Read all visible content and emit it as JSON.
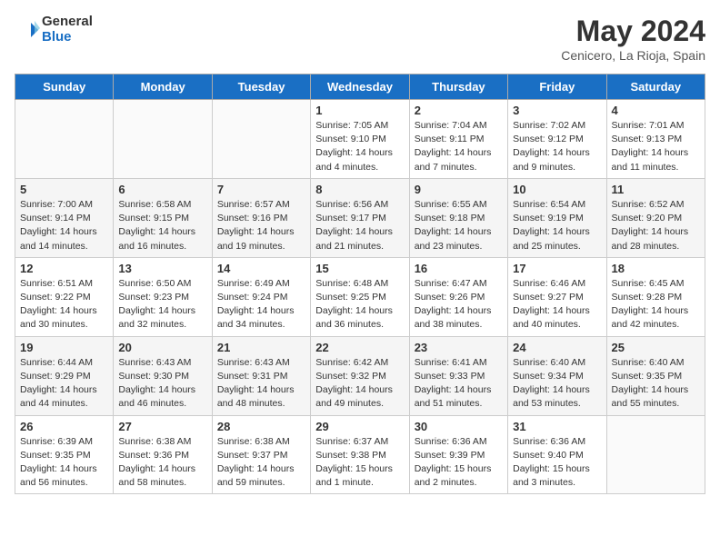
{
  "header": {
    "logo_line1": "General",
    "logo_line2": "Blue",
    "month_title": "May 2024",
    "subtitle": "Cenicero, La Rioja, Spain"
  },
  "days_of_week": [
    "Sunday",
    "Monday",
    "Tuesday",
    "Wednesday",
    "Thursday",
    "Friday",
    "Saturday"
  ],
  "weeks": [
    [
      {
        "day": "",
        "info": ""
      },
      {
        "day": "",
        "info": ""
      },
      {
        "day": "",
        "info": ""
      },
      {
        "day": "1",
        "info": "Sunrise: 7:05 AM\nSunset: 9:10 PM\nDaylight: 14 hours\nand 4 minutes."
      },
      {
        "day": "2",
        "info": "Sunrise: 7:04 AM\nSunset: 9:11 PM\nDaylight: 14 hours\nand 7 minutes."
      },
      {
        "day": "3",
        "info": "Sunrise: 7:02 AM\nSunset: 9:12 PM\nDaylight: 14 hours\nand 9 minutes."
      },
      {
        "day": "4",
        "info": "Sunrise: 7:01 AM\nSunset: 9:13 PM\nDaylight: 14 hours\nand 11 minutes."
      }
    ],
    [
      {
        "day": "5",
        "info": "Sunrise: 7:00 AM\nSunset: 9:14 PM\nDaylight: 14 hours\nand 14 minutes."
      },
      {
        "day": "6",
        "info": "Sunrise: 6:58 AM\nSunset: 9:15 PM\nDaylight: 14 hours\nand 16 minutes."
      },
      {
        "day": "7",
        "info": "Sunrise: 6:57 AM\nSunset: 9:16 PM\nDaylight: 14 hours\nand 19 minutes."
      },
      {
        "day": "8",
        "info": "Sunrise: 6:56 AM\nSunset: 9:17 PM\nDaylight: 14 hours\nand 21 minutes."
      },
      {
        "day": "9",
        "info": "Sunrise: 6:55 AM\nSunset: 9:18 PM\nDaylight: 14 hours\nand 23 minutes."
      },
      {
        "day": "10",
        "info": "Sunrise: 6:54 AM\nSunset: 9:19 PM\nDaylight: 14 hours\nand 25 minutes."
      },
      {
        "day": "11",
        "info": "Sunrise: 6:52 AM\nSunset: 9:20 PM\nDaylight: 14 hours\nand 28 minutes."
      }
    ],
    [
      {
        "day": "12",
        "info": "Sunrise: 6:51 AM\nSunset: 9:22 PM\nDaylight: 14 hours\nand 30 minutes."
      },
      {
        "day": "13",
        "info": "Sunrise: 6:50 AM\nSunset: 9:23 PM\nDaylight: 14 hours\nand 32 minutes."
      },
      {
        "day": "14",
        "info": "Sunrise: 6:49 AM\nSunset: 9:24 PM\nDaylight: 14 hours\nand 34 minutes."
      },
      {
        "day": "15",
        "info": "Sunrise: 6:48 AM\nSunset: 9:25 PM\nDaylight: 14 hours\nand 36 minutes."
      },
      {
        "day": "16",
        "info": "Sunrise: 6:47 AM\nSunset: 9:26 PM\nDaylight: 14 hours\nand 38 minutes."
      },
      {
        "day": "17",
        "info": "Sunrise: 6:46 AM\nSunset: 9:27 PM\nDaylight: 14 hours\nand 40 minutes."
      },
      {
        "day": "18",
        "info": "Sunrise: 6:45 AM\nSunset: 9:28 PM\nDaylight: 14 hours\nand 42 minutes."
      }
    ],
    [
      {
        "day": "19",
        "info": "Sunrise: 6:44 AM\nSunset: 9:29 PM\nDaylight: 14 hours\nand 44 minutes."
      },
      {
        "day": "20",
        "info": "Sunrise: 6:43 AM\nSunset: 9:30 PM\nDaylight: 14 hours\nand 46 minutes."
      },
      {
        "day": "21",
        "info": "Sunrise: 6:43 AM\nSunset: 9:31 PM\nDaylight: 14 hours\nand 48 minutes."
      },
      {
        "day": "22",
        "info": "Sunrise: 6:42 AM\nSunset: 9:32 PM\nDaylight: 14 hours\nand 49 minutes."
      },
      {
        "day": "23",
        "info": "Sunrise: 6:41 AM\nSunset: 9:33 PM\nDaylight: 14 hours\nand 51 minutes."
      },
      {
        "day": "24",
        "info": "Sunrise: 6:40 AM\nSunset: 9:34 PM\nDaylight: 14 hours\nand 53 minutes."
      },
      {
        "day": "25",
        "info": "Sunrise: 6:40 AM\nSunset: 9:35 PM\nDaylight: 14 hours\nand 55 minutes."
      }
    ],
    [
      {
        "day": "26",
        "info": "Sunrise: 6:39 AM\nSunset: 9:35 PM\nDaylight: 14 hours\nand 56 minutes."
      },
      {
        "day": "27",
        "info": "Sunrise: 6:38 AM\nSunset: 9:36 PM\nDaylight: 14 hours\nand 58 minutes."
      },
      {
        "day": "28",
        "info": "Sunrise: 6:38 AM\nSunset: 9:37 PM\nDaylight: 14 hours\nand 59 minutes."
      },
      {
        "day": "29",
        "info": "Sunrise: 6:37 AM\nSunset: 9:38 PM\nDaylight: 15 hours\nand 1 minute."
      },
      {
        "day": "30",
        "info": "Sunrise: 6:36 AM\nSunset: 9:39 PM\nDaylight: 15 hours\nand 2 minutes."
      },
      {
        "day": "31",
        "info": "Sunrise: 6:36 AM\nSunset: 9:40 PM\nDaylight: 15 hours\nand 3 minutes."
      },
      {
        "day": "",
        "info": ""
      }
    ]
  ]
}
